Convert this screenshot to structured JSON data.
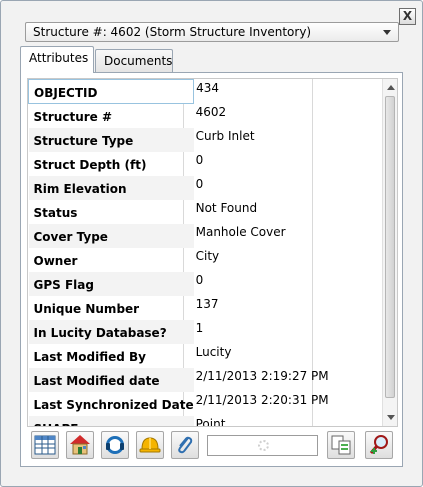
{
  "window": {
    "close_label": "X"
  },
  "structure_select": {
    "selected": "Structure #: 4602 (Storm Structure Inventory)"
  },
  "tabs": [
    {
      "label": "Attributes",
      "active": true
    },
    {
      "label": "Documents",
      "active": false
    }
  ],
  "attributes": [
    {
      "field": "OBJECTID",
      "value": "434"
    },
    {
      "field": "Structure #",
      "value": "4602"
    },
    {
      "field": "Structure Type",
      "value": "Curb Inlet"
    },
    {
      "field": "Struct Depth (ft)",
      "value": "0"
    },
    {
      "field": "Rim Elevation",
      "value": "0"
    },
    {
      "field": "Status",
      "value": "Not Found"
    },
    {
      "field": "Cover Type",
      "value": "Manhole Cover"
    },
    {
      "field": "Owner",
      "value": "City"
    },
    {
      "field": "GPS Flag",
      "value": "0"
    },
    {
      "field": "Unique Number",
      "value": "137"
    },
    {
      "field": "In Lucity Database?",
      "value": "1"
    },
    {
      "field": "Last Modified By",
      "value": "Lucity"
    },
    {
      "field": "Last Modified date",
      "value": "2/11/2013 2:19:27 PM"
    },
    {
      "field": "Last Synchronized Date",
      "value": "2/11/2013 2:20:31 PM"
    },
    {
      "field": "SHAPE",
      "value": "Point"
    }
  ],
  "toolbar": {
    "icons": [
      "table-icon",
      "home-icon",
      "headset-icon",
      "hardhat-icon",
      "paperclip-icon",
      "copy-icon",
      "zoom-to-icon"
    ],
    "search_value": ""
  }
}
